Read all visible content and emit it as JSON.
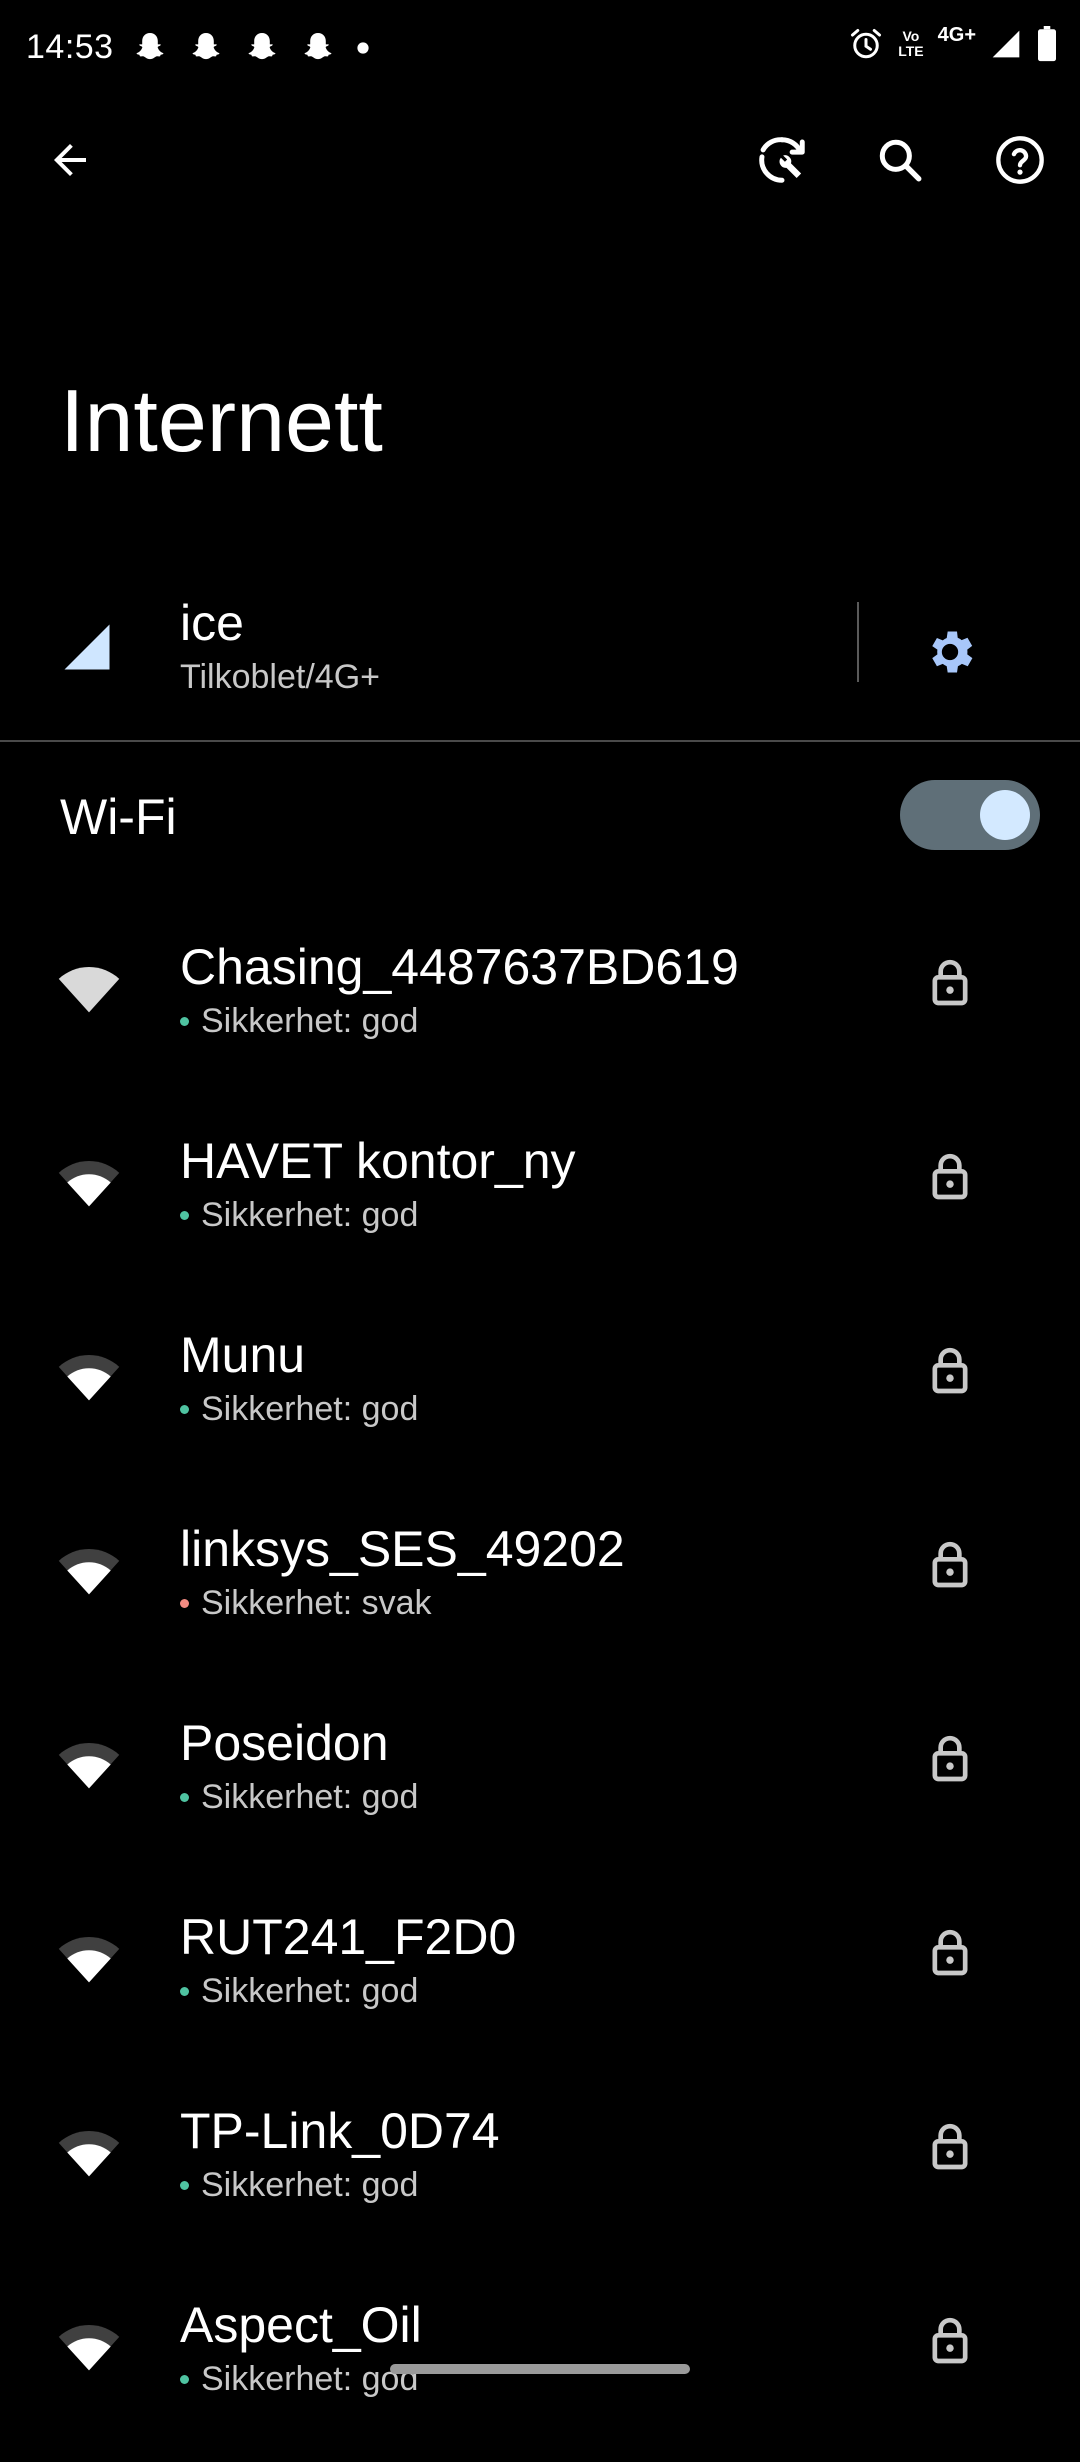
{
  "status_bar": {
    "time": "14:53",
    "notification_icons": [
      "snapchat-icon",
      "snapchat-icon",
      "snapchat-icon",
      "snapchat-icon",
      "more-dot-icon"
    ],
    "volte_line1": "Vo",
    "volte_line2": "LTE",
    "network_type": "4G+",
    "right_icons": [
      "alarm-icon",
      "volte-icon",
      "signal-icon",
      "battery-icon"
    ]
  },
  "app_bar": {
    "icons": [
      "back-arrow-icon",
      "sync-wrench-icon",
      "search-icon",
      "help-icon"
    ]
  },
  "page": {
    "title": "Internett"
  },
  "mobile": {
    "name": "ice",
    "status": "Tilkoblet/4G+",
    "icon": "cellular-signal-icon",
    "settings_icon": "gear-icon"
  },
  "wifi": {
    "label": "Wi-Fi",
    "enabled": true,
    "networks": [
      {
        "name": "Chasing_4487637BD619",
        "security": "Sikkerhet: god",
        "level": "good"
      },
      {
        "name": "HAVET kontor_ny",
        "security": "Sikkerhet: god",
        "level": "good"
      },
      {
        "name": "Munu",
        "security": "Sikkerhet: god",
        "level": "good"
      },
      {
        "name": "linksys_SES_49202",
        "security": "Sikkerhet: svak",
        "level": "weak"
      },
      {
        "name": "Poseidon",
        "security": "Sikkerhet: god",
        "level": "good"
      },
      {
        "name": "RUT241_F2D0",
        "security": "Sikkerhet: god",
        "level": "good"
      },
      {
        "name": "TP-Link_0D74",
        "security": "Sikkerhet: god",
        "level": "good"
      },
      {
        "name": "Aspect_Oil",
        "security": "Sikkerhet: god",
        "level": "good"
      }
    ]
  },
  "colors": {
    "background": "#000000",
    "accent": "#a8c7fa",
    "security_good": "#4fc3a1",
    "security_weak": "#f28b82",
    "toggle_track": "#5f6f78",
    "toggle_knob": "#d3e9ff"
  }
}
